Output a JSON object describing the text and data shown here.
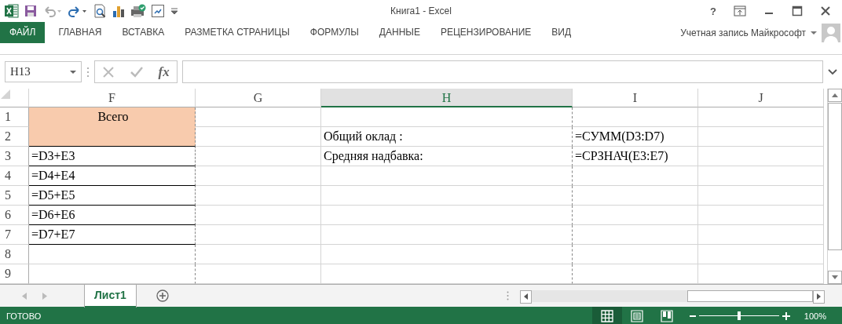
{
  "window": {
    "title": "Книга1 - Excel",
    "help": "?"
  },
  "ribbon_tabs": [
    {
      "label": "ФАЙЛ",
      "kind": "file"
    },
    {
      "label": "ГЛАВНАЯ",
      "kind": "tab"
    },
    {
      "label": "ВСТАВКА",
      "kind": "tab"
    },
    {
      "label": "РАЗМЕТКА СТРАНИЦЫ",
      "kind": "tab"
    },
    {
      "label": "ФОРМУЛЫ",
      "kind": "tab"
    },
    {
      "label": "ДАННЫЕ",
      "kind": "tab"
    },
    {
      "label": "РЕЦЕНЗИРОВАНИЕ",
      "kind": "tab"
    },
    {
      "label": "ВИД",
      "kind": "tab"
    }
  ],
  "account": {
    "name": "Учетная запись Майкрософт"
  },
  "formula_bar": {
    "name_box": "H13",
    "function_label": "fx"
  },
  "columns": [
    {
      "label": "F",
      "selected": false,
      "page_break": true
    },
    {
      "label": "G",
      "selected": false,
      "page_break": false
    },
    {
      "label": "H",
      "selected": true,
      "page_break": true
    },
    {
      "label": "I",
      "selected": false,
      "page_break": false
    },
    {
      "label": "J",
      "selected": false,
      "page_break": false
    }
  ],
  "rows": [
    {
      "number": "1",
      "cells": [
        {
          "text": "Всего",
          "kind": "merged-fill"
        },
        null,
        null,
        null,
        null
      ]
    },
    {
      "number": "2",
      "cells": [
        null,
        null,
        {
          "text": "Общий оклад :",
          "kind": "plain"
        },
        {
          "text": "=СУММ(D3:D7)",
          "kind": "plain"
        },
        null
      ]
    },
    {
      "number": "3",
      "cells": [
        {
          "text": "=D3+E3",
          "kind": "bordered"
        },
        null,
        {
          "text": "Средняя надбавка:",
          "kind": "plain"
        },
        {
          "text": "=СРЗНАЧ(E3:E7)",
          "kind": "plain"
        },
        null
      ]
    },
    {
      "number": "4",
      "cells": [
        {
          "text": "=D4+E4",
          "kind": "bordered"
        },
        null,
        null,
        null,
        null
      ]
    },
    {
      "number": "5",
      "cells": [
        {
          "text": "=D5+E5",
          "kind": "bordered"
        },
        null,
        null,
        null,
        null
      ]
    },
    {
      "number": "6",
      "cells": [
        {
          "text": "=D6+E6",
          "kind": "bordered"
        },
        null,
        null,
        null,
        null
      ]
    },
    {
      "number": "7",
      "cells": [
        {
          "text": "=D7+E7",
          "kind": "bordered"
        },
        null,
        null,
        null,
        null
      ]
    },
    {
      "number": "8",
      "cells": [
        null,
        null,
        null,
        null,
        null
      ]
    },
    {
      "number": "9",
      "cells": [
        null,
        null,
        null,
        null,
        null
      ]
    }
  ],
  "sheets": [
    {
      "label": "Лист1",
      "selected": true
    }
  ],
  "status_bar": {
    "text": "ГОТОВО",
    "views": [
      {
        "kind": "normal",
        "selected": true
      },
      {
        "kind": "page-layout",
        "selected": false
      },
      {
        "kind": "page-break",
        "selected": false
      }
    ],
    "zoom": {
      "level": 0.5,
      "reading": "100%"
    }
  }
}
